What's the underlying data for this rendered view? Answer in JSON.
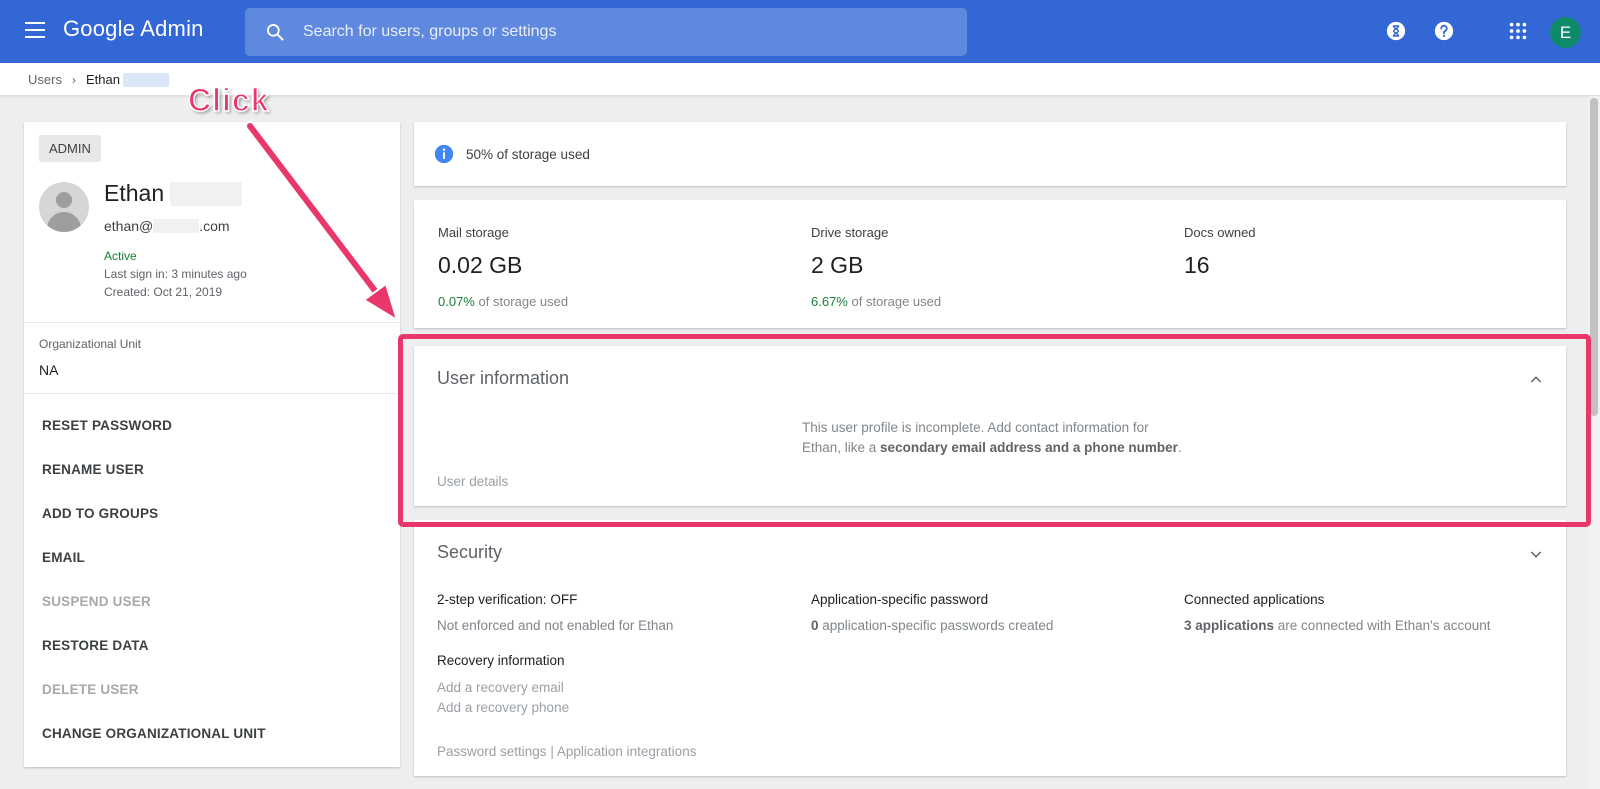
{
  "header": {
    "app_title": "Google Admin",
    "search_placeholder": "Search for users, groups or settings",
    "avatar_initial": "E",
    "brand_color": "#3367d6"
  },
  "breadcrumb": {
    "parent": "Users",
    "current": "Ethan"
  },
  "user": {
    "role_badge": "ADMIN",
    "first_name": "Ethan",
    "email_prefix": "ethan@",
    "email_suffix": ".com",
    "status": "Active",
    "last_sign_in": "Last sign in: 3 minutes ago",
    "created": "Created: Oct 21, 2019",
    "org_unit_label": "Organizational Unit",
    "org_unit_value": "NA"
  },
  "actions": [
    {
      "label": "RESET PASSWORD",
      "enabled": true
    },
    {
      "label": "RENAME USER",
      "enabled": true
    },
    {
      "label": "ADD TO GROUPS",
      "enabled": true
    },
    {
      "label": "EMAIL",
      "enabled": true
    },
    {
      "label": "SUSPEND USER",
      "enabled": false
    },
    {
      "label": "RESTORE DATA",
      "enabled": true
    },
    {
      "label": "DELETE USER",
      "enabled": false
    },
    {
      "label": "CHANGE ORGANIZATIONAL UNIT",
      "enabled": true
    }
  ],
  "storage_banner": "50% of storage used",
  "stats": {
    "mail": {
      "label": "Mail storage",
      "value": "0.02 GB",
      "pct": "0.07%",
      "suffix": "of storage used"
    },
    "drive": {
      "label": "Drive storage",
      "value": "2 GB",
      "pct": "6.67%",
      "suffix": "of storage used"
    },
    "docs": {
      "label": "Docs owned",
      "value": "16"
    }
  },
  "user_information": {
    "title": "User information",
    "message_line1": "This user profile is incomplete. Add contact information for",
    "message_line2_prefix": "Ethan, like a ",
    "message_line2_bold": "secondary email address and a phone number",
    "message_line2_suffix": ".",
    "details_link": "User details"
  },
  "security": {
    "title": "Security",
    "two_step_label": "2-step verification:",
    "two_step_value": "OFF",
    "two_step_desc": "Not enforced and not enabled for Ethan",
    "app_password_label": "Application-specific password",
    "app_password_count": "0",
    "app_password_desc": "application-specific passwords created",
    "connected_label": "Connected applications",
    "connected_count": "3 applications",
    "connected_desc": "are connected with Ethan's account",
    "recovery_label": "Recovery information",
    "recovery_email": "Add a recovery email",
    "recovery_phone": "Add a recovery phone",
    "link_password_settings": "Password settings",
    "link_separator": "|",
    "link_app_integrations": "Application integrations"
  },
  "annotation": {
    "label": "Click",
    "color": "#e8386b"
  }
}
